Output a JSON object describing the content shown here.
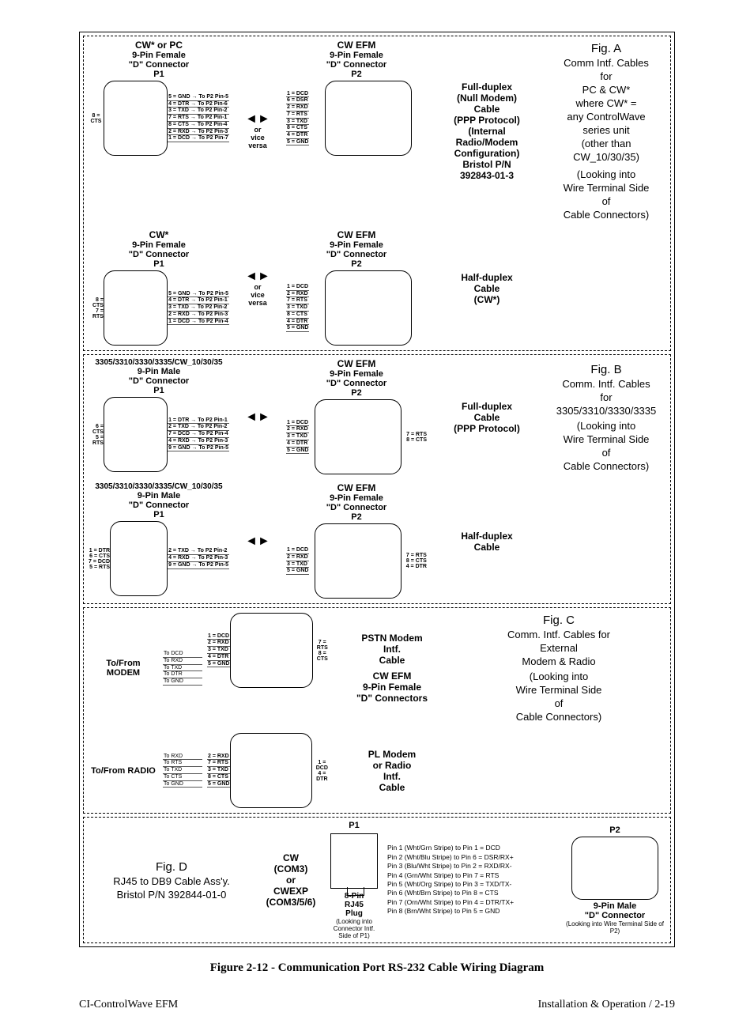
{
  "figA": {
    "title": "Fig. A",
    "lines": [
      "Comm Intf. Cables",
      "for",
      "PC & CW*",
      "where CW* =",
      "any ControlWave",
      "series unit",
      "(other than",
      "CW_10/30/35)",
      "(Looking into",
      "Wire Terminal Side",
      "of",
      "Cable Connectors)"
    ],
    "left_hdr1": "CW* or PC",
    "left_hdr2": "9-Pin Female",
    "left_hdr3": "\"D\" Connector",
    "left_p": "P1",
    "right_hdr1": "CW EFM",
    "right_hdr2": "9-Pin Female",
    "right_hdr3": "\"D\" Connector",
    "right_p": "P2",
    "desc1": [
      "Full-duplex",
      "(Null Modem)",
      "Cable",
      "(PPP Protocol)",
      "(Internal Radio/Modem",
      "Configuration)",
      "Bristol P/N",
      "392843-01-3"
    ],
    "left_wires1": [
      "5 = GND → To P2 Pin-5",
      "4 = DTR → To P2 Pin-6",
      "3 = TXD → To P2 Pin-2",
      "7 = RTS → To P2 Pin-1",
      "8 = CTS → To P2 Pin-4",
      "2 = RXD → To P2 Pin-3",
      "1 = DCD → To P2 Pin-7"
    ],
    "right_wires1": [
      "1 = DCD",
      "6 = DSR",
      "2 = RXD",
      "7 = RTS",
      "3 = TXD",
      "8 = CTS",
      "4 = DTR",
      "5 = GND"
    ],
    "arrow1": [
      "or",
      "vice",
      "versa"
    ],
    "left2_hdr1": "CW*",
    "desc2": [
      "Half-duplex",
      "Cable",
      "(CW*)"
    ],
    "left_wires2": [
      "5 = GND → To P2 Pin-5",
      "4 = DTR → To P2 Pin-1",
      "3 = TXD → To P2 Pin-2",
      "2 = RXD → To P2 Pin-3",
      "1 = DCD → To P2 Pin-4"
    ],
    "right_wires2": [
      "1 = DCD",
      "2 = RXD",
      "7 = RTS",
      "3 = TXD",
      "8 = CTS",
      "4 = DTR",
      "5 = GND"
    ],
    "side_left1": "8 = CTS",
    "side_left2a": "8 = CTS",
    "side_left2b": "7 = RTS"
  },
  "figB": {
    "title": "Fig. B",
    "lines": [
      "Comm. Intf. Cables",
      "for",
      "3305/3310/3330/3335",
      "",
      "(Looking into",
      "Wire Terminal Side",
      "of",
      "Cable Connectors)"
    ],
    "left_hdr1": "3305/3310/3330/3335/CW_10/30/35",
    "left_hdr2": "9-Pin Male",
    "left_hdr3": "\"D\" Connector",
    "left_p": "P1",
    "right_hdr1": "CW EFM",
    "right_hdr2": "9-Pin Female",
    "right_hdr3": "\"D\" Connector",
    "right_p": "P2",
    "desc1": [
      "Full-duplex",
      "Cable",
      "(PPP Protocol)"
    ],
    "left_wires1": [
      "1 = DTR → To P2 Pin-1",
      "2 = TXD → To P2 Pin-2",
      "7 = DCD → To P2 Pin-4",
      "4 = RXD → To P2 Pin-3",
      "9 = GND → To P2 Pin-5"
    ],
    "right_wires1": [
      "1 = DCD",
      "2 = RXD",
      "3 = TXD",
      "4 = DTR",
      "5 = GND"
    ],
    "side_left1a": "6 = CTS",
    "side_left1b": "5 = RTS",
    "side_right1a": "7 = RTS",
    "side_right1b": "8 = CTS",
    "arrow": [
      "◄",
      "►"
    ],
    "desc2": [
      "Half-duplex",
      "Cable"
    ],
    "left_wires2": [
      "2 = TXD → To P2 Pin-2",
      "4 = RXD → To P2 Pin-3",
      "9 = GND → To P2 Pin-5"
    ],
    "right_wires2": [
      "1 = DCD",
      "2 = RXD",
      "3 = TXD",
      "5 = GND"
    ],
    "side_left2": "1 = DTR\n6 = CTS\n7 = DCD\n5 = RTS",
    "side_right2": "7 = RTS\n8 = CTS\n4 = DTR"
  },
  "figC": {
    "title": "Fig. C",
    "lines": [
      "Comm. Intf. Cables for",
      "External",
      "Modem & Radio",
      "",
      "(Looking into",
      "Wire Terminal Side",
      "of",
      "Cable Connectors)"
    ],
    "modem_lbl": "To/From MODEM",
    "modem_sig": [
      "To DCD",
      "To RXD",
      "To TXD",
      "To DTR",
      "To GND"
    ],
    "modem_wires": [
      "1 = DCD",
      "2 = RXD",
      "3 = TXD",
      "4 = DTR",
      "5 = GND"
    ],
    "modem_side": [
      "7 = RTS",
      "8 = CTS"
    ],
    "modem_desc": [
      "PSTN Modem",
      "Intf.",
      "Cable"
    ],
    "conn_hdr": [
      "CW EFM",
      "9-Pin Female",
      "\"D\" Connectors"
    ],
    "radio_lbl": "To/From RADIO",
    "radio_sig": [
      "To RXD",
      "To RTS",
      "To TXD",
      "To CTS",
      "To GND"
    ],
    "radio_wires": [
      "2 = RXD",
      "7 = RTS",
      "3 = TXD",
      "8 = CTS",
      "5 = GND"
    ],
    "radio_side": [
      "1 = DCD",
      "4 = DTR"
    ],
    "radio_desc": [
      "PL Modem",
      "or Radio",
      "Intf.",
      "Cable"
    ]
  },
  "figD": {
    "title": "Fig. D",
    "sub1": "RJ45 to DB9 Cable Ass'y.",
    "sub2": "Bristol P/N 392844-01-0",
    "cw": [
      "CW",
      "(COM3)",
      "or",
      "CWEXP",
      "(COM3/5/6)"
    ],
    "p1": "P1",
    "plug": [
      "8-Pin",
      "RJ45",
      "Plug"
    ],
    "plug_note": "(Looking into Connector Intf. Side of P1)",
    "pins": [
      "Pin 1 (Wht/Grn Stripe) to Pin 1 = DCD",
      "Pin 2 (Wht/Blu Stripe) to Pin 6 = DSR/RX+",
      "Pin 3 (Blu/Wht Stripe) to Pin 2 = RXD/RX-",
      "Pin 4 (Grn/Wht Stripe) to Pin 7 = RTS",
      "Pin 5 (Wht/Org Stripe) to Pin 3 = TXD/TX-",
      "Pin 6 (Wht/Brn Stripe) to Pin 8 = CTS",
      "Pin 7 (Orn/Wht Stripe) to Pin 4 = DTR/TX+",
      "Pin 8 (Brn/Wht Stripe) to Pin 5 = GND"
    ],
    "p2": "P2",
    "p2_hdr": [
      "9-Pin Male",
      "\"D\" Connector"
    ],
    "p2_note": "(Looking into Wire Terminal Side of P2)"
  },
  "caption": "Figure 2-12 - Communication Port RS-232 Cable Wiring Diagram",
  "footer_left": "CI-ControlWave EFM",
  "footer_right": "Installation & Operation / 2-19"
}
